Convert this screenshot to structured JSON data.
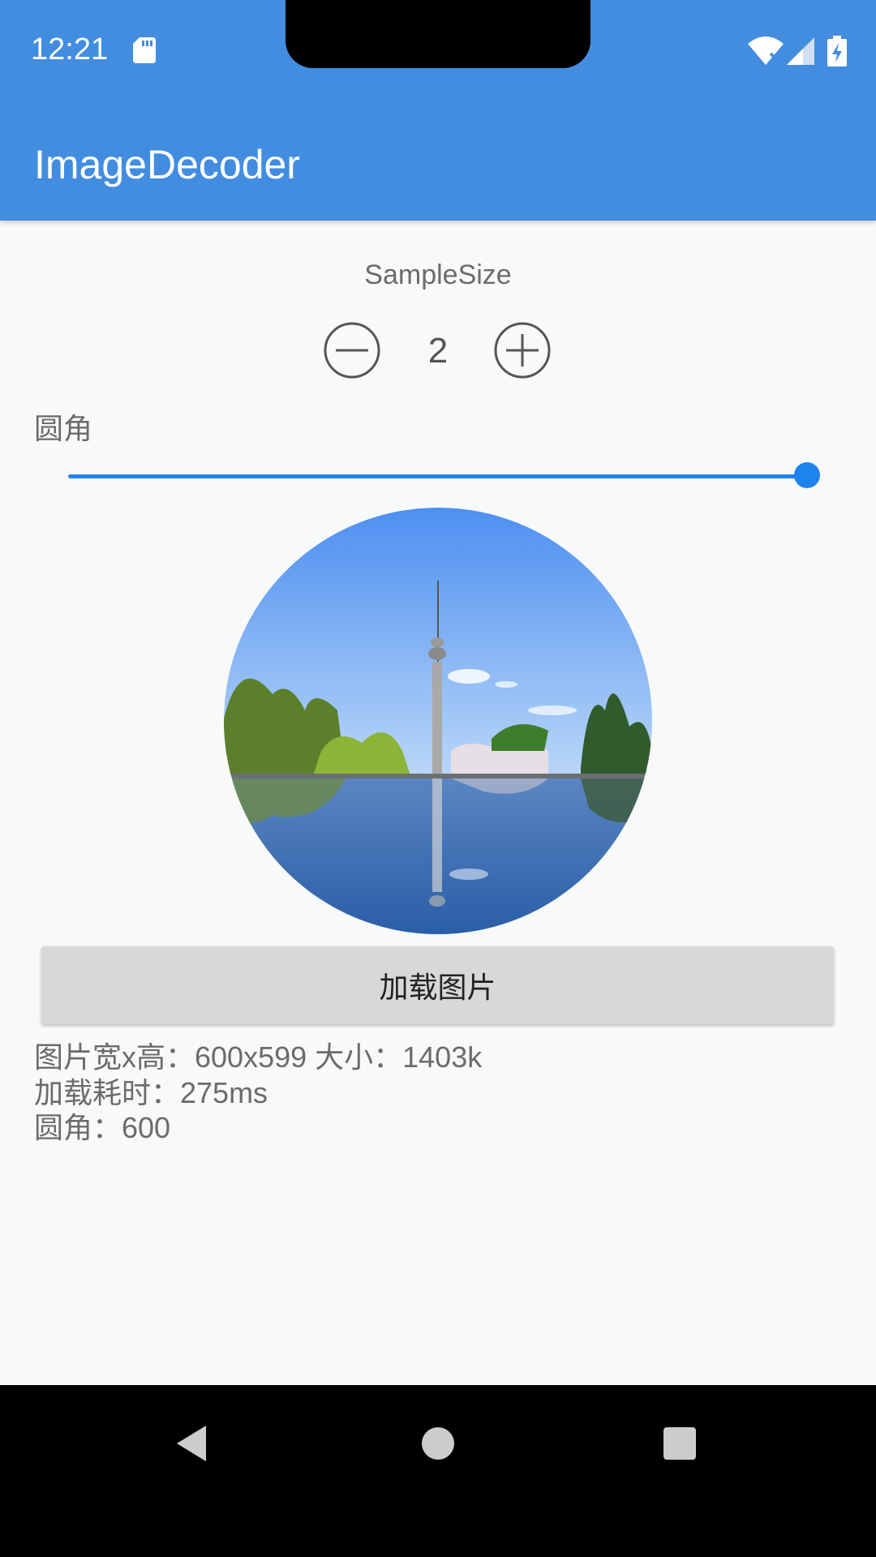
{
  "status_bar": {
    "time": "12:21"
  },
  "app_bar": {
    "title": "ImageDecoder"
  },
  "sample_size": {
    "label": "SampleSize",
    "value": "2"
  },
  "corner": {
    "label": "圆角",
    "slider_fraction": 1.0
  },
  "load_button": {
    "label": "加载图片"
  },
  "info": {
    "line1": "图片宽x高：600x599 大小：1403k",
    "line2": "加载耗时：275ms",
    "line3": "圆角：600"
  },
  "colors": {
    "accent": "#428de0",
    "slider": "#1f83ee",
    "background": "#f8fafa"
  }
}
